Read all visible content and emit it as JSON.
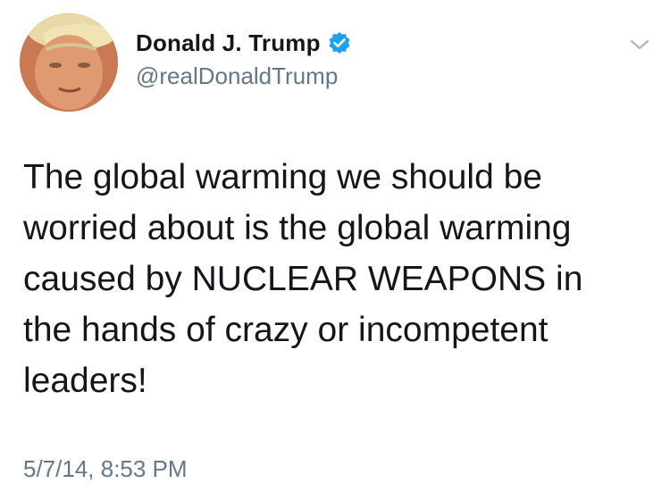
{
  "user": {
    "display_name": "Donald J. Trump",
    "handle": "@realDonaldTrump",
    "verified": true,
    "avatar_icon": "profile-photo"
  },
  "tweet": {
    "text": "The global warming we should be\nworried about is the global warming\ncaused by NUCLEAR WEAPONS in\nthe hands of crazy or incompetent\nleaders!",
    "timestamp": "5/7/14, 8:53 PM"
  },
  "icons": {
    "verified": "verified-badge-icon",
    "menu": "chevron-down-icon"
  },
  "colors": {
    "verified_blue": "#1da1f2",
    "secondary_text": "#657786",
    "primary_text": "#14171a"
  }
}
